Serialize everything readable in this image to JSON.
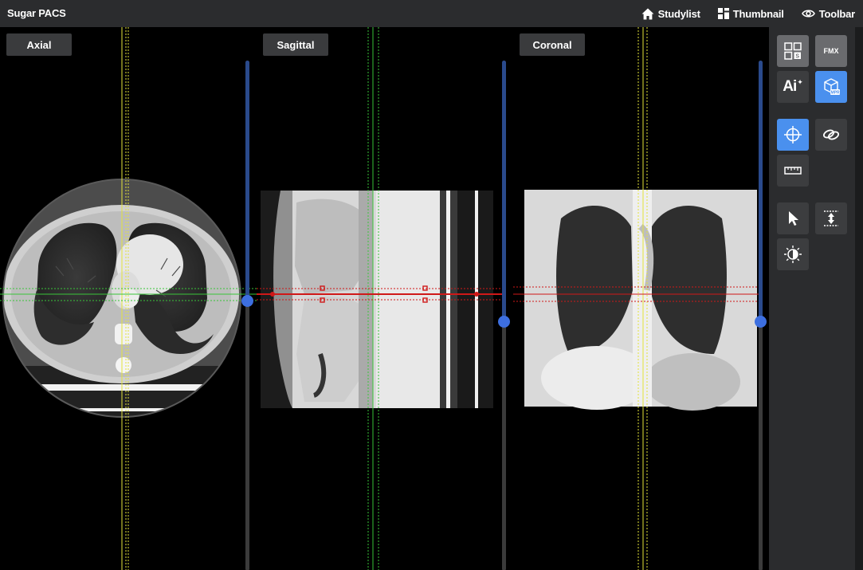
{
  "app": {
    "title": "Sugar PACS"
  },
  "nav": [
    {
      "label": "Studylist",
      "icon": "home-icon"
    },
    {
      "label": "Thumbnail",
      "icon": "grid-icon"
    },
    {
      "label": "Toolbar",
      "icon": "eye-icon"
    }
  ],
  "viewports": {
    "axial": {
      "label": "Axial"
    },
    "sagittal": {
      "label": "Sagittal"
    },
    "coronal": {
      "label": "Coronal"
    }
  },
  "tools": {
    "fmx_label": "FMX",
    "ai_label": "Ai",
    "items": [
      {
        "name": "layout-icon",
        "state": "light"
      },
      {
        "name": "fmx-button",
        "state": "light"
      },
      {
        "name": "ai-icon",
        "state": "normal"
      },
      {
        "name": "mpr-3d-icon",
        "state": "active"
      },
      {
        "name": "crosshair-icon",
        "state": "active"
      },
      {
        "name": "link-icon",
        "state": "normal"
      },
      {
        "name": "ruler-icon",
        "state": "normal"
      },
      {
        "name": "pointer-icon",
        "state": "normal"
      },
      {
        "name": "stack-scroll-icon",
        "state": "normal"
      },
      {
        "name": "window-level-icon",
        "state": "normal"
      }
    ]
  },
  "colors": {
    "accent": "#4a90ee",
    "topbar": "#2b2c2e",
    "axial_line": "#e3e33a",
    "sagittal_line": "#39c539",
    "coronal_line": "#d01818",
    "slider_knob": "#3d6fe0"
  }
}
